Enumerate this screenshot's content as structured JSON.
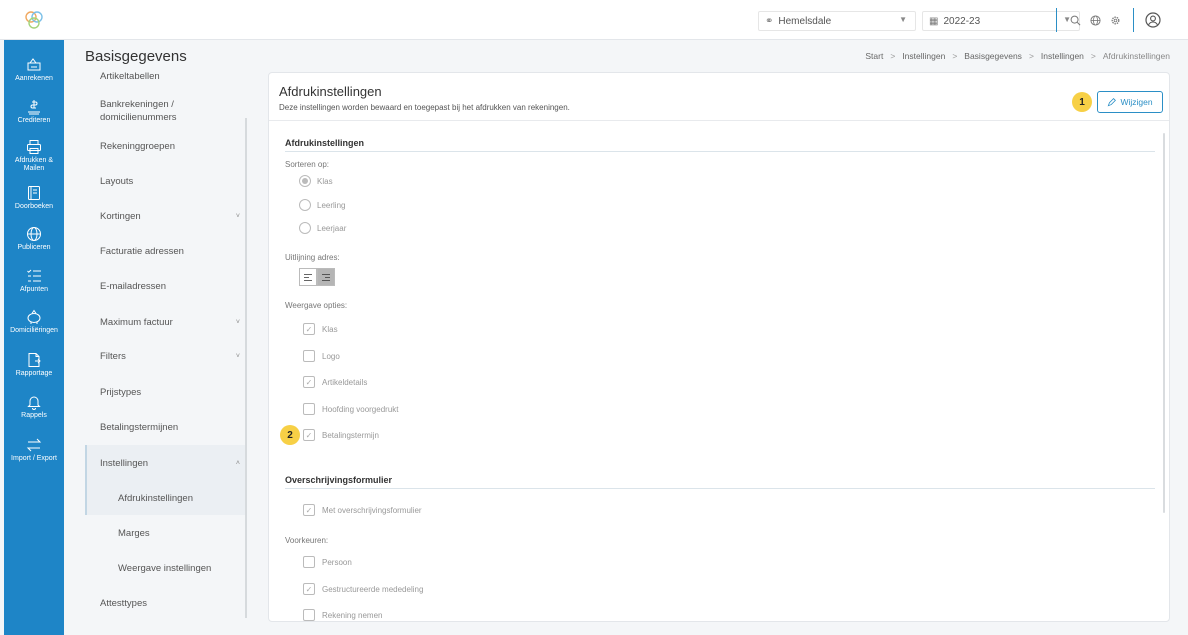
{
  "topbar": {
    "school": "Hemelsdale",
    "year": "2022-23"
  },
  "sidebar": {
    "items": [
      {
        "label": "Aanrekenen",
        "icon": "bill-icon"
      },
      {
        "label": "Crediteren",
        "icon": "credit-icon"
      },
      {
        "label": "Afdrukken & Mailen",
        "icon": "printer-icon"
      },
      {
        "label": "Doorboeken",
        "icon": "ledger-icon"
      },
      {
        "label": "Publiceren",
        "icon": "globe-icon"
      },
      {
        "label": "Afpunten",
        "icon": "checklist-icon"
      },
      {
        "label": "Domiciliëringen",
        "icon": "piggy-bank-icon"
      },
      {
        "label": "Rapportage",
        "icon": "report-icon"
      },
      {
        "label": "Rappels",
        "icon": "bell-icon"
      },
      {
        "label": "Import / Export",
        "icon": "transfer-icon"
      }
    ]
  },
  "page_title": "Basisgegevens",
  "submenu": {
    "items": [
      {
        "label": "Artikeltabellen"
      },
      {
        "label": "Bankrekeningen / domicilienummers"
      },
      {
        "label": "Rekeninggroepen"
      },
      {
        "label": "Layouts"
      },
      {
        "label": "Kortingen",
        "chevron": "˅"
      },
      {
        "label": "Facturatie adressen"
      },
      {
        "label": "E-mailadressen"
      },
      {
        "label": "Maximum factuur",
        "chevron": "˅"
      },
      {
        "label": "Filters",
        "chevron": "˅"
      },
      {
        "label": "Prijstypes"
      },
      {
        "label": "Betalingstermijnen"
      },
      {
        "label": "Instellingen",
        "chevron": "˄"
      },
      {
        "label": "Afdrukinstellingen"
      },
      {
        "label": "Marges"
      },
      {
        "label": "Weergave instellingen"
      },
      {
        "label": "Attesttypes"
      }
    ]
  },
  "breadcrumb": [
    "Start",
    "Instellingen",
    "Basisgegevens",
    "Instellingen",
    "Afdrukinstellingen"
  ],
  "breadcrumb_sep": ">",
  "card": {
    "title": "Afdrukinstellingen",
    "subtitle": "Deze instellingen worden bewaard en toegepast bij het afdrukken van rekeningen.",
    "edit_label": "Wijzigen",
    "badge1": "1",
    "badge2": "2",
    "section1": "Afdrukinstellingen",
    "sort_label": "Sorteren op:",
    "sort_options": [
      {
        "label": "Klas",
        "selected": true
      },
      {
        "label": "Leerling",
        "selected": false
      },
      {
        "label": "Leerjaar",
        "selected": false
      }
    ],
    "align_label": "Uitlijning adres:",
    "display_label": "Weergave opties:",
    "display_options": [
      {
        "label": "Klas",
        "checked": true
      },
      {
        "label": "Logo",
        "checked": false
      },
      {
        "label": "Artikeldetails",
        "checked": true
      },
      {
        "label": "Hoofding voorgedrukt",
        "checked": false
      },
      {
        "label": "Betalingstermijn",
        "checked": true
      }
    ],
    "section2": "Overschrijvingsformulier",
    "transfer_option": {
      "label": "Met overschrijvingsformulier",
      "checked": true
    },
    "prefs_label": "Voorkeuren:",
    "prefs_options": [
      {
        "label": "Persoon",
        "checked": false
      },
      {
        "label": "Gestructureerde mededeling",
        "checked": true
      },
      {
        "label": "Rekening nemen",
        "checked": false
      }
    ]
  }
}
